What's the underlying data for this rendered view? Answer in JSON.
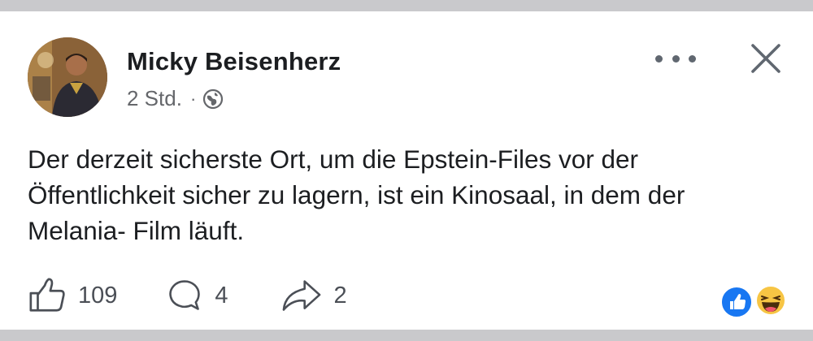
{
  "post": {
    "author": "Micky Beisenherz",
    "time": "2 Std.",
    "separator": "·",
    "privacy_icon": "globe-icon",
    "text": "Der derzeit sicherste Ort, um die Epstein-Files vor der Öffentlichkeit sicher zu lagern, ist ein Kinosaal, in dem der Melania- Film läuft."
  },
  "header_actions": {
    "more_icon": "more-horizontal-icon",
    "close_icon": "close-icon"
  },
  "actions": {
    "likes": "109",
    "comments": "4",
    "shares": "2"
  },
  "reactions": [
    "like-reaction-icon",
    "haha-reaction-icon"
  ],
  "colors": {
    "like_blue": "#1877f2",
    "text": "#1c1e21",
    "secondary": "#65676b",
    "haha_yellow": "#f7c544"
  }
}
